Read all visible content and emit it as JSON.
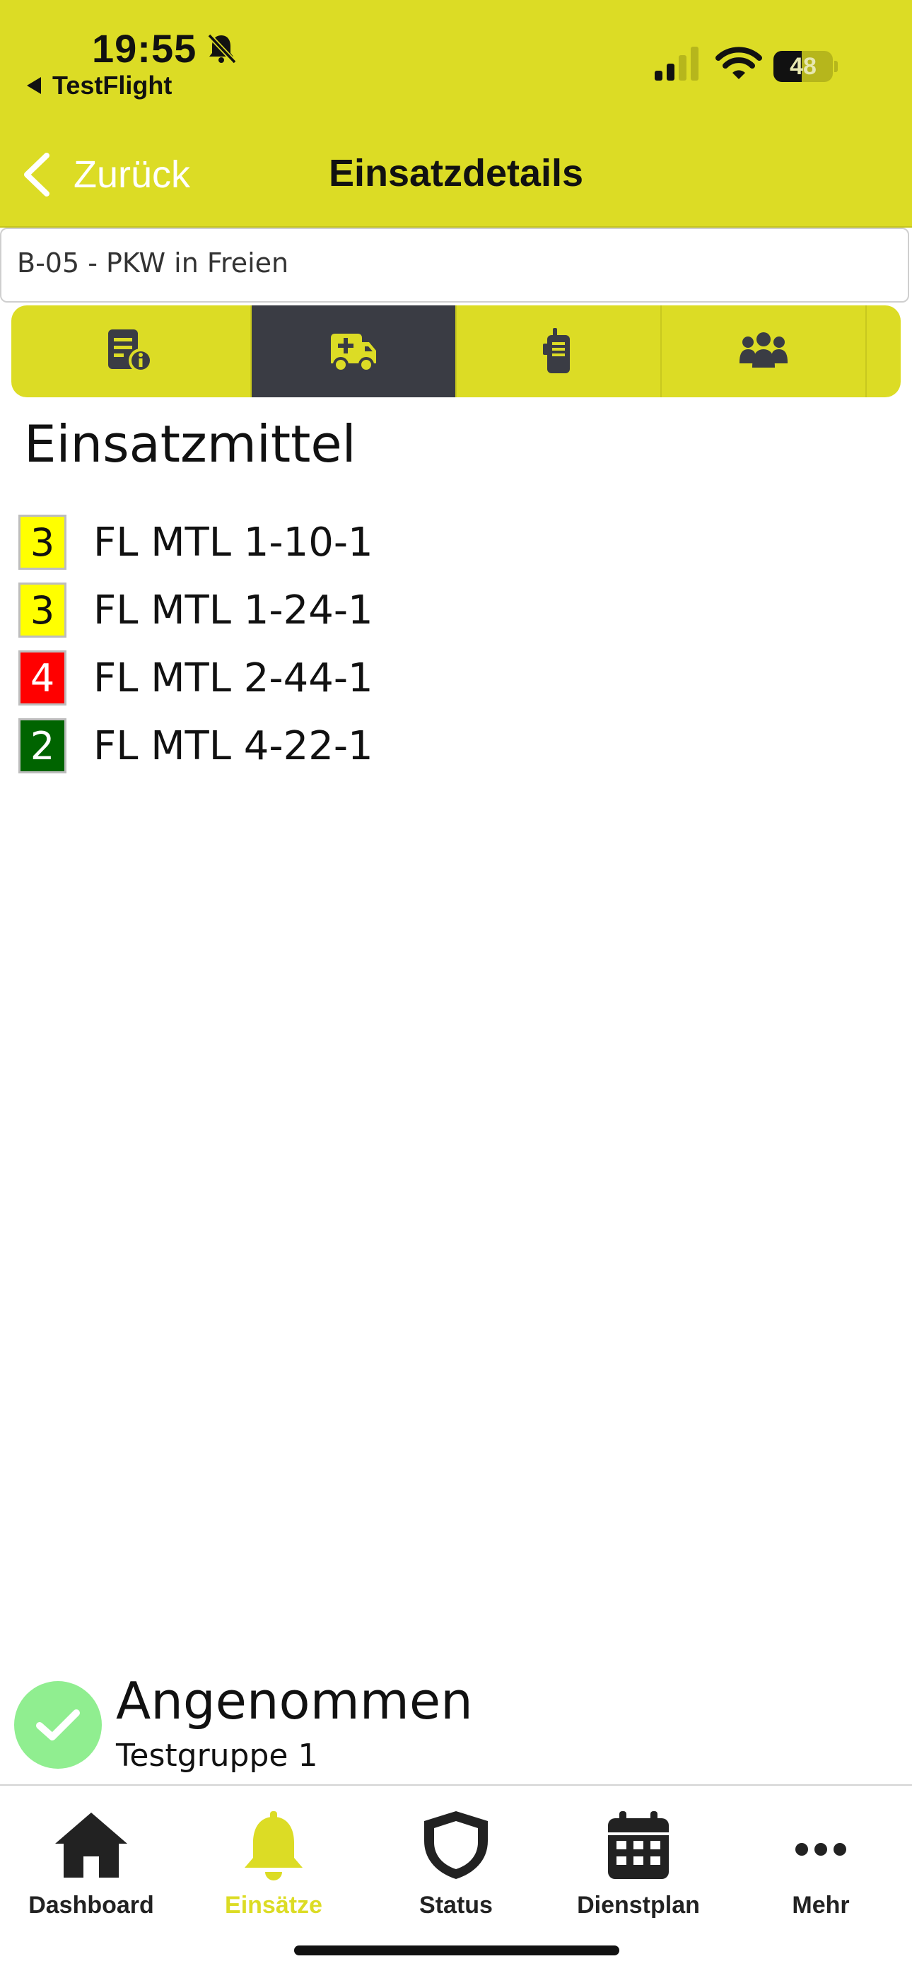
{
  "status_bar": {
    "time": "19:55",
    "back_app": "TestFlight",
    "battery_level": "48",
    "battery_fraction": 0.48
  },
  "header": {
    "back_label": "Zurück",
    "title": "Einsatzdetails"
  },
  "incident": {
    "title": "B-05 - PKW in Freien"
  },
  "tabs": [
    {
      "icon": "info-document-icon",
      "active": false
    },
    {
      "icon": "ambulance-icon",
      "active": true
    },
    {
      "icon": "radio-icon",
      "active": false
    },
    {
      "icon": "people-group-icon",
      "active": false
    }
  ],
  "resources": {
    "heading": "Einsatzmittel",
    "items": [
      {
        "status": "3",
        "name": "FL MTL 1-10-1",
        "color": "#ffff00",
        "text_color": "#111111"
      },
      {
        "status": "3",
        "name": "FL MTL 1-24-1",
        "color": "#ffff00",
        "text_color": "#111111"
      },
      {
        "status": "4",
        "name": "FL MTL 2-44-1",
        "color": "#ff0000",
        "text_color": "#ffffff"
      },
      {
        "status": "2",
        "name": "FL MTL 4-22-1",
        "color": "#006400",
        "text_color": "#ffffff"
      }
    ]
  },
  "response": {
    "status": "Angenommen",
    "group": "Testgruppe 1",
    "icon": "checkmark-icon"
  },
  "bottom_nav": [
    {
      "label": "Dashboard",
      "icon": "home-icon",
      "active": false
    },
    {
      "label": "Einsätze",
      "icon": "bell-icon",
      "active": true
    },
    {
      "label": "Status",
      "icon": "shield-icon",
      "active": false
    },
    {
      "label": "Dienstplan",
      "icon": "calendar-icon",
      "active": false
    },
    {
      "label": "Mehr",
      "icon": "more-dots-icon",
      "active": false
    }
  ],
  "colors": {
    "accent": "#dcdc25",
    "active_tab": "#3a3c44",
    "accepted": "#90ee90"
  }
}
